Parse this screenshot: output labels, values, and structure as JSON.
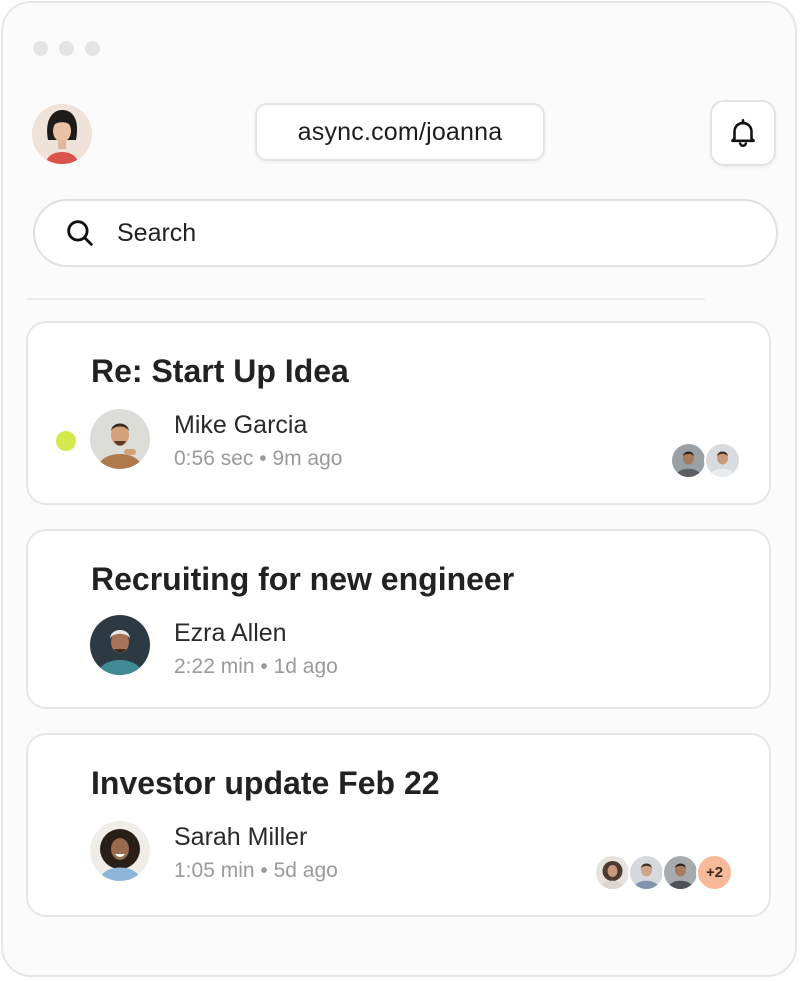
{
  "window": {
    "traffic_lights": [
      "dot",
      "dot",
      "dot"
    ]
  },
  "header": {
    "user_avatar": "user-avatar-woman",
    "url": "async.com/joanna",
    "notification_icon": "bell-icon"
  },
  "search": {
    "placeholder": "Search",
    "icon": "search-icon"
  },
  "threads": [
    {
      "title": "Re: Start Up Idea",
      "author": "Mike Garcia",
      "duration": "0:56 sec",
      "time": "9m ago",
      "meta": "0:56 sec • 9m ago",
      "unread": true,
      "participants": [
        "participant-avatar",
        "participant-avatar"
      ]
    },
    {
      "title": "Recruiting for new engineer",
      "author": "Ezra Allen",
      "duration": "2:22 min",
      "time": "1d ago",
      "meta": "2:22 min • 1d ago",
      "unread": false,
      "participants": []
    },
    {
      "title": "Investor update Feb 22",
      "author": "Sarah Miller",
      "duration": "1:05 min",
      "time": "5d ago",
      "meta": "1:05 min • 5d ago",
      "unread": false,
      "participants": [
        "participant-avatar",
        "participant-avatar",
        "participant-avatar"
      ],
      "more_participants": "+2"
    }
  ],
  "colors": {
    "unread_dot": "#d3e84b",
    "more_badge": "#f6b99a",
    "meta_text": "#9a9a9a",
    "border": "#e6e6e6"
  }
}
